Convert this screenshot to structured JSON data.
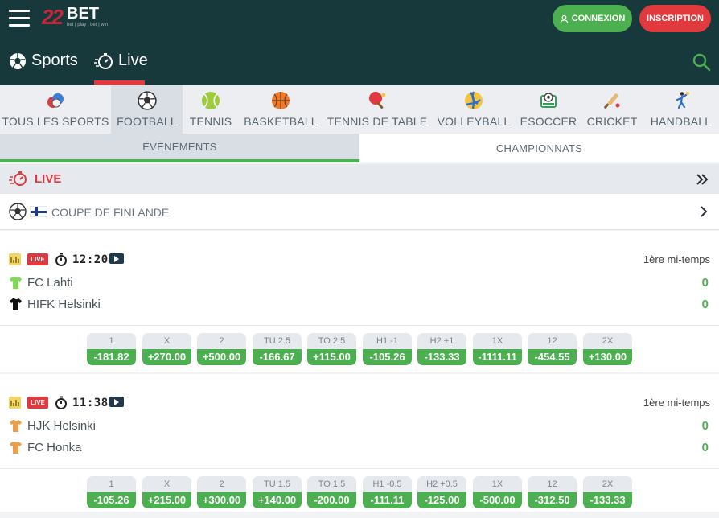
{
  "header": {
    "logo_number": "22",
    "logo_text": "BET",
    "logo_tagline": "bet | play | bet | win",
    "login_label": "CONNEXION",
    "register_label": "INSCRIPTION",
    "nav": [
      {
        "label": "Sports",
        "icon": "soccer-ball-icon",
        "active": false
      },
      {
        "label": "Live",
        "icon": "live-stopwatch-icon",
        "active": true
      }
    ],
    "accent_color": "#e0393e",
    "bg_color": "#17393c",
    "green": "#4caf50"
  },
  "sports": [
    {
      "label": "TOUS LES SPORTS",
      "icon": "all-sports-icon",
      "active": false
    },
    {
      "label": "FOOTBALL",
      "icon": "soccer-ball-icon",
      "active": true
    },
    {
      "label": "TENNIS",
      "icon": "tennis-ball-icon",
      "active": false
    },
    {
      "label": "BASKETBALL",
      "icon": "basketball-icon",
      "active": false
    },
    {
      "label": "TENNIS DE TABLE",
      "icon": "ping-pong-icon",
      "active": false
    },
    {
      "label": "VOLLEYBALL",
      "icon": "volleyball-icon",
      "active": false
    },
    {
      "label": "ESOCCER",
      "icon": "esoccer-icon",
      "active": false
    },
    {
      "label": "CRICKET",
      "icon": "cricket-icon",
      "active": false
    },
    {
      "label": "HANDBALL",
      "icon": "handball-icon",
      "active": false
    }
  ],
  "subtabs": [
    {
      "label": "ÉVÈNEMENTS",
      "active": true
    },
    {
      "label": "CHAMPIONNATS",
      "active": false
    }
  ],
  "live_section": {
    "title": "LIVE"
  },
  "league": {
    "name": "COUPE DE FINLANDE",
    "flag": "finland-flag-icon"
  },
  "matches": [
    {
      "badge": "LIVE",
      "time": "12:20",
      "period": "1ère mi-temps",
      "teams": [
        {
          "name": "FC Lahti",
          "score": "0",
          "shirt_color": "#7ed957"
        },
        {
          "name": "HIFK Helsinki",
          "score": "0",
          "shirt_color": "#111111"
        }
      ],
      "odds": [
        {
          "label": "1",
          "value": "-181.82"
        },
        {
          "label": "X",
          "value": "+270.00"
        },
        {
          "label": "2",
          "value": "+500.00"
        },
        {
          "label": "TU 2.5",
          "value": "-166.67"
        },
        {
          "label": "TO 2.5",
          "value": "+115.00"
        },
        {
          "label": "H1 -1",
          "value": "-105.26"
        },
        {
          "label": "H2 +1",
          "value": "-133.33"
        },
        {
          "label": "1X",
          "value": "-1111.11"
        },
        {
          "label": "12",
          "value": "-454.55"
        },
        {
          "label": "2X",
          "value": "+130.00"
        }
      ]
    },
    {
      "badge": "LIVE",
      "time": "11:38",
      "period": "1ère mi-temps",
      "teams": [
        {
          "name": "HJK Helsinki",
          "score": "0",
          "shirt_color": "#e8a04c"
        },
        {
          "name": "FC Honka",
          "score": "0",
          "shirt_color": "#e8a04c"
        }
      ],
      "odds": [
        {
          "label": "1",
          "value": "-105.26"
        },
        {
          "label": "X",
          "value": "+215.00"
        },
        {
          "label": "2",
          "value": "+300.00"
        },
        {
          "label": "TU 1.5",
          "value": "+140.00"
        },
        {
          "label": "TO 1.5",
          "value": "-200.00"
        },
        {
          "label": "H1 -0.5",
          "value": "-111.11"
        },
        {
          "label": "H2 +0.5",
          "value": "-125.00"
        },
        {
          "label": "1X",
          "value": "-500.00"
        },
        {
          "label": "12",
          "value": "-312.50"
        },
        {
          "label": "2X",
          "value": "-133.33"
        }
      ]
    }
  ]
}
